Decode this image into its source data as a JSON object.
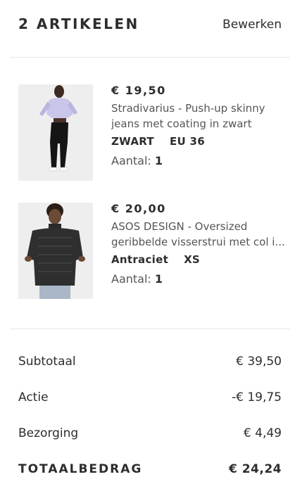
{
  "header": {
    "title": "2 ARTIKELEN",
    "edit_label": "Bewerken"
  },
  "items": [
    {
      "price": "€ 19,50",
      "name_line1": "Stradivarius - Push-up skinny",
      "name_line2": "jeans met coating in zwart",
      "color": "ZWART",
      "size": "EU 36",
      "qty_label": "Aantal:",
      "qty": "1",
      "image_icon": "product-photo-jeans"
    },
    {
      "price": "€ 20,00",
      "name_line1": "ASOS DESIGN - Oversized",
      "name_line2": "geribbelde visserstrui met col i...",
      "color": "Antraciet",
      "size": "XS",
      "qty_label": "Aantal:",
      "qty": "1",
      "image_icon": "product-photo-sweater"
    }
  ],
  "summary": {
    "subtotal_label": "Subtotaal",
    "subtotal_value": "€ 39,50",
    "discount_label": "Actie",
    "discount_value": "-€ 19,75",
    "delivery_label": "Bezorging",
    "delivery_value": "€ 4,49",
    "total_label": "TOTAALBEDRAG",
    "total_value": "€ 24,24"
  }
}
